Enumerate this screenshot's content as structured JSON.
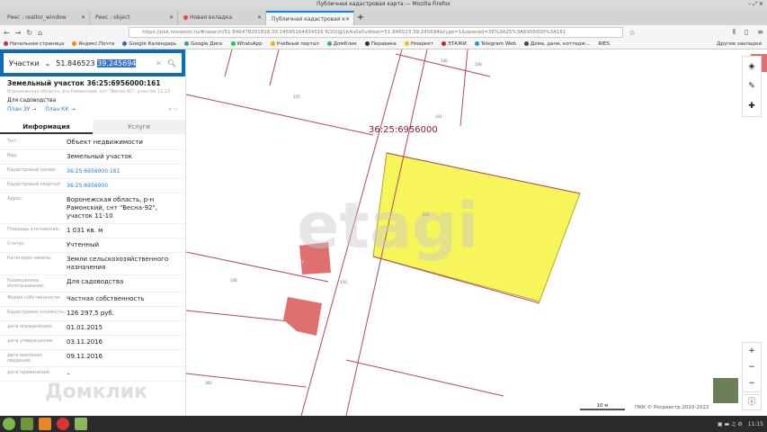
{
  "window": {
    "title": "Публичная кадастровая карта — Mozilla Firefox"
  },
  "tabs": [
    {
      "label": "Реес : realtor_window"
    },
    {
      "label": "Реес : object"
    },
    {
      "label": "Новая вкладка"
    },
    {
      "label": "Публичная кадастровая к"
    }
  ],
  "url": "https://pkk.rosreestr.ru/#/search/51.846478291816,39.24595164434516 6/20/@1b4u0a5vdfext=51.846523 39.245694&type=1&opened=36%3A25%3A6956000%3A161",
  "bookmarks": [
    "Начальная страница",
    "Яндекс.Почта",
    "Google Календарь",
    "Google Диск",
    "WhatsApp",
    "Учебный портал",
    "ДомКлик",
    "Перавика",
    "Нмаркет",
    "ЭТАЖИ",
    "Telegram Web",
    "Домa, дачи, коттедж...",
    "RIES"
  ],
  "other_bookmarks": "Другие закладки",
  "search": {
    "category": "Участки",
    "coord1": "51.846523",
    "coord2": "39.245694"
  },
  "parcel": {
    "title": "Земельный участок 36:25:6956000:161",
    "address_short": "Воронежская область, р-н Рамонский, снт \"Весна-92\", участок 11-10",
    "purpose": "Для садоводства",
    "plan_zu": "План ЗУ →",
    "plan_kk": "План КК →"
  },
  "side_tabs": {
    "info": "Информация",
    "services": "Услуги"
  },
  "rows": [
    {
      "k": "Тип:",
      "v": "Объект недвижимости"
    },
    {
      "k": "Вид:",
      "v": "Земельный участок"
    },
    {
      "k": "Кадастровый номер:",
      "v": "36:25:6956000:161",
      "link": true
    },
    {
      "k": "Кадастровый квартал:",
      "v": "36:25:6956000",
      "link": true
    },
    {
      "k": "Адрес:",
      "v": "Воронежская область, р-н Рамонский, снт \"Весна-92\", участок 11-10"
    },
    {
      "k": "Площадь уточненная:",
      "v": "1 031 кв. м"
    },
    {
      "k": "Статус:",
      "v": "Учтенный"
    },
    {
      "k": "Категория земель:",
      "v": "Земли сельскохозяйственного назначения"
    },
    {
      "k": "Разрешенное использование:",
      "v": "Для садоводства"
    },
    {
      "k": "Форма собственности:",
      "v": "Частная собственность"
    },
    {
      "k": "Кадастровая стоимость:",
      "v": "126 297,5 руб."
    },
    {
      "k": "дата определения:",
      "v": "01.01.2015"
    },
    {
      "k": "дата утверждения:",
      "v": "03.11.2016"
    },
    {
      "k": "дата внесения сведений:",
      "v": "09.11.2016"
    },
    {
      "k": "дата применения:",
      "v": "–"
    }
  ],
  "map": {
    "quarter_label": "36:25:6956000",
    "labels": [
      "147",
      "140",
      "140",
      "141",
      "146",
      "150",
      "165",
      "161",
      "21 :27"
    ],
    "watermark_etagi": "etagi",
    "watermark_domclick": "Домклик",
    "scale": "10 м",
    "attribution": "ПКК © Росреестр 2010-2022"
  },
  "taskbar": {
    "time": "11:15"
  }
}
